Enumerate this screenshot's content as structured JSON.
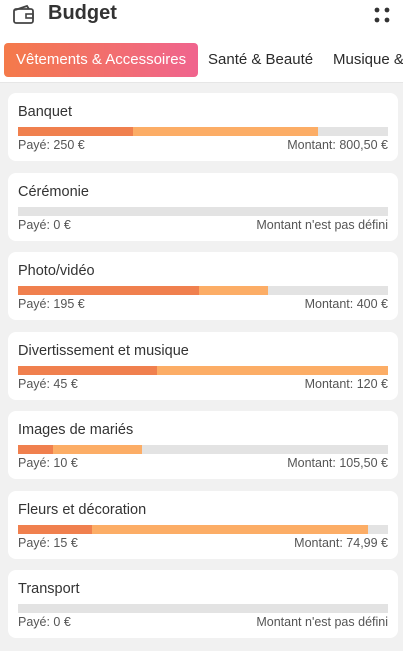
{
  "app": {
    "title": "Budget",
    "left_icon": "wallet-icon",
    "right_icon": "grid-dots-icon"
  },
  "tabs": [
    {
      "label": "Vêtements & Accessoires",
      "active": true
    },
    {
      "label": "Santé & Beauté",
      "active": false
    },
    {
      "label": "Musique &",
      "active": false
    }
  ],
  "colors": {
    "accent_start": "#f47a4a",
    "accent_end": "#f0648e",
    "paid_fill": "#f0804e",
    "total_fill": "#fcad66",
    "track": "#e3e3e3"
  },
  "items": [
    {
      "name": "Banquet",
      "paid": "Payé: 250 €",
      "amount": "Montant: 800,50 €",
      "paid_frac": 0.31,
      "total_frac": 0.81
    },
    {
      "name": "Cérémonie",
      "paid": "Payé: 0 €",
      "amount": "Montant n'est pas défini",
      "paid_frac": 0,
      "total_frac": 0
    },
    {
      "name": "Photo/vidéo",
      "paid": "Payé: 195 €",
      "amount": "Montant: 400 €",
      "paid_frac": 0.49,
      "total_frac": 0.676
    },
    {
      "name": "Divertissement et musique",
      "paid": "Payé: 45 €",
      "amount": "Montant: 120 €",
      "paid_frac": 0.375,
      "total_frac": 1.0
    },
    {
      "name": "Images de mariés",
      "paid": "Payé: 10 €",
      "amount": "Montant: 105,50 €",
      "paid_frac": 0.095,
      "total_frac": 0.335
    },
    {
      "name": "Fleurs et décoration",
      "paid": "Payé: 15 €",
      "amount": "Montant: 74,99 €",
      "paid_frac": 0.2,
      "total_frac": 0.946
    },
    {
      "name": "Transport",
      "paid": "Payé: 0 €",
      "amount": "Montant n'est pas défini",
      "paid_frac": 0,
      "total_frac": 0
    }
  ]
}
